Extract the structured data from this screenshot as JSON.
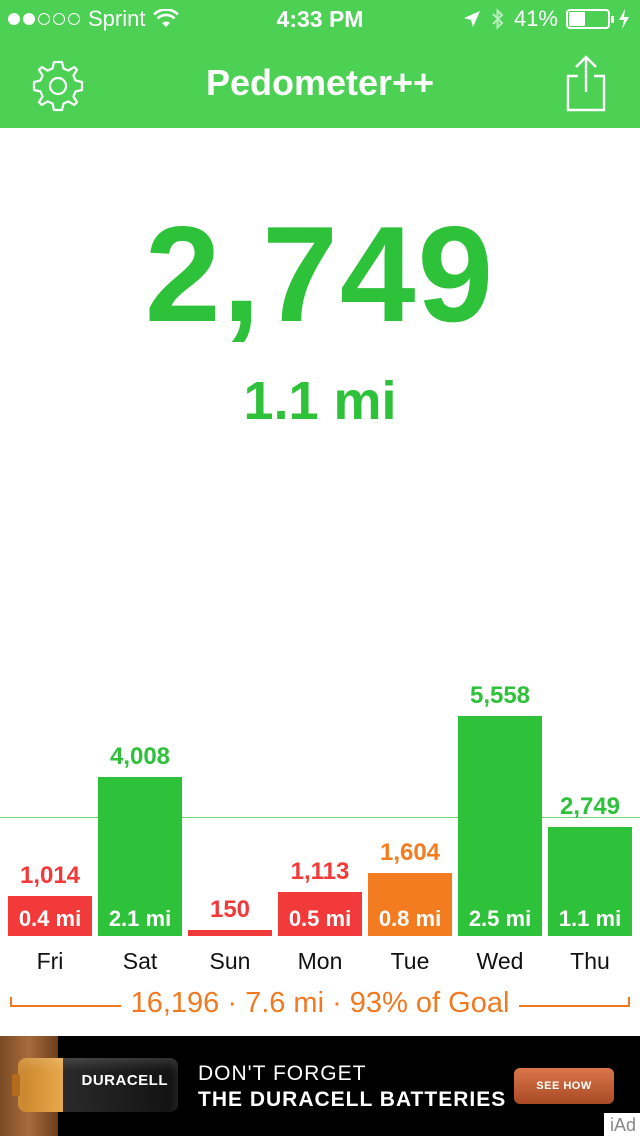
{
  "status_bar": {
    "carrier": "Sprint",
    "time": "4:33 PM",
    "battery_percent": "41%",
    "battery_level": 0.41,
    "signal_bars_filled": 2,
    "signal_bars_total": 5
  },
  "nav": {
    "title": "Pedometer++",
    "settings_icon": "gear-icon",
    "share_icon": "share-icon"
  },
  "today": {
    "steps": "2,749",
    "distance": "1.1 mi"
  },
  "colors": {
    "green": "#2ec13a",
    "red": "#f23a3a",
    "orange": "#f47c20",
    "header_green": "#4cd155"
  },
  "chart_data": {
    "type": "bar",
    "goal_steps": 3000,
    "ylim": [
      0,
      5558
    ],
    "categories": [
      "Fri",
      "Sat",
      "Sun",
      "Mon",
      "Tue",
      "Wed",
      "Thu"
    ],
    "values": [
      1014,
      4008,
      150,
      1113,
      1604,
      5558,
      2749
    ],
    "steps_labels": [
      "1,014",
      "4,008",
      "150",
      "1,113",
      "1,604",
      "5,558",
      "2,749"
    ],
    "distance_labels": [
      "0.4 mi",
      "2.1 mi",
      "",
      "0.5 mi",
      "0.8 mi",
      "2.5 mi",
      "1.1 mi"
    ],
    "bar_colors": [
      "red",
      "green",
      "red",
      "red",
      "orange",
      "green",
      "green"
    ]
  },
  "summary": {
    "text": "16,196 · 7.6 mi · 93% of Goal"
  },
  "ad": {
    "brand": "DURACELL",
    "line1": "DON'T FORGET",
    "line2": "THE DURACELL BATTERIES",
    "button": "SEE HOW",
    "tag": "iAd"
  }
}
